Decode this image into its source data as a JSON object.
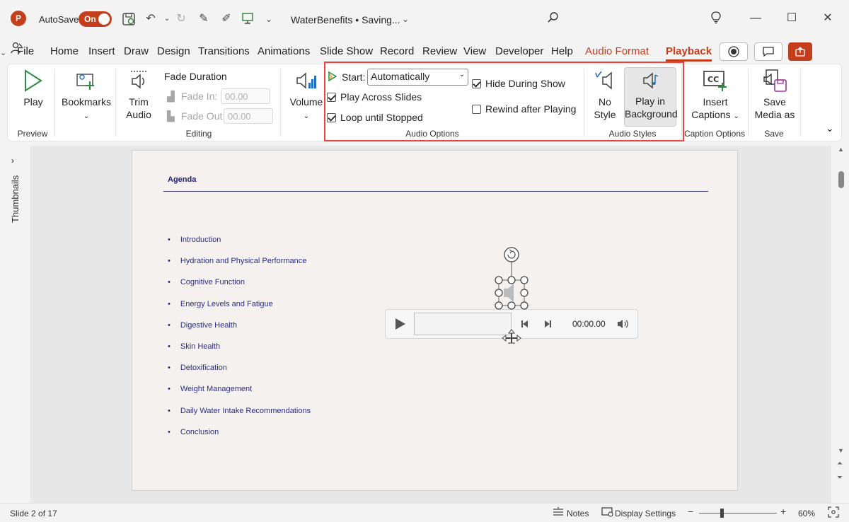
{
  "titlebar": {
    "app_icon": "P",
    "autosave_label": "AutoSave",
    "autosave_state": "On",
    "document_title": "WaterBenefits • Saving...",
    "title_chevron": "⌄"
  },
  "tabs": [
    "File",
    "Home",
    "Insert",
    "Draw",
    "Design",
    "Transitions",
    "Animations",
    "Slide Show",
    "Record",
    "Review",
    "View",
    "Developer",
    "Help",
    "Audio Format",
    "Playback"
  ],
  "ribbon": {
    "play_label": "Play",
    "preview_group": "Preview",
    "bookmarks_label": "Bookmarks",
    "trim_label_1": "Trim",
    "trim_label_2": "Audio",
    "fade_duration": "Fade Duration",
    "fade_in_label": "Fade In:",
    "fade_in_value": "00.00",
    "fade_out_label": "Fade Out:",
    "fade_out_value": "00.00",
    "editing_group": "Editing",
    "volume_label": "Volume",
    "start_label": "Start:",
    "start_value": "Automatically",
    "play_across_slides": "Play Across Slides",
    "loop_until_stopped": "Loop until Stopped",
    "hide_during_show": "Hide During Show",
    "rewind_after_playing": "Rewind after Playing",
    "audio_options_group": "Audio Options",
    "no_style_1": "No",
    "no_style_2": "Style",
    "play_bg_1": "Play in",
    "play_bg_2": "Background",
    "audio_styles_group": "Audio Styles",
    "insert_captions_1": "Insert",
    "insert_captions_2": "Captions",
    "caption_options_group": "Caption Options",
    "save_media_1": "Save",
    "save_media_2": "Media as",
    "save_group": "Save"
  },
  "sidebar": {
    "thumbnails_label": "Thumbnails"
  },
  "slide": {
    "title": "Agenda",
    "items": [
      "Introduction",
      "Hydration and Physical Performance",
      "Cognitive Function",
      "Energy Levels and Fatigue",
      "Digestive Health",
      "Skin Health",
      "Detoxification",
      "Weight Management",
      "Daily Water Intake Recommendations",
      "Conclusion"
    ]
  },
  "player": {
    "time": "00:00.00"
  },
  "status": {
    "slide_info": "Slide 2 of 17",
    "notes_label": "Notes",
    "display_settings_label": "Display Settings",
    "zoom": "60%",
    "zoom_fraction": 0.6
  }
}
